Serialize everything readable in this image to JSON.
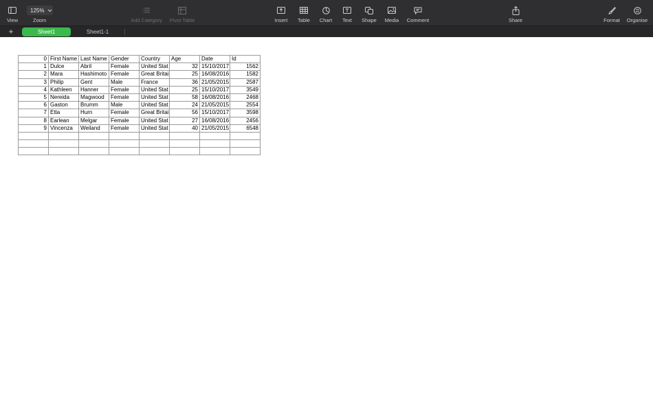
{
  "toolbar": {
    "view_label": "View",
    "zoom_value": "125%",
    "zoom_label": "Zoom",
    "add_category_label": "Add Category",
    "pivot_table_label": "Pivot Table",
    "insert_label": "Insert",
    "table_label": "Table",
    "chart_label": "Chart",
    "text_label": "Text",
    "shape_label": "Shape",
    "media_label": "Media",
    "comment_label": "Comment",
    "share_label": "Share",
    "format_label": "Format",
    "organise_label": "Organise"
  },
  "tabs": {
    "add_symbol": "+",
    "sheet1": "Sheet1",
    "sheet2": "Sheet1-1"
  },
  "colors": {
    "toolbar_bg": "#2f2f31",
    "active_tab": "#3bb94c"
  },
  "table": {
    "headers": [
      "0",
      "First Name",
      "Last Name",
      "Gender",
      "Country",
      "Age",
      "Date",
      "Id"
    ],
    "rows": [
      [
        "1",
        "Dulce",
        "Abril",
        "Female",
        "United Stat",
        "32",
        "15/10/2017",
        "1562"
      ],
      [
        "2",
        "Mara",
        "Hashimoto",
        "Female",
        "Great Britai",
        "25",
        "16/08/2016",
        "1582"
      ],
      [
        "3",
        "Philip",
        "Gent",
        "Male",
        "France",
        "36",
        "21/05/2015",
        "2587"
      ],
      [
        "4",
        "Kathleen",
        "Hanner",
        "Female",
        "United Stat",
        "25",
        "15/10/2017",
        "3549"
      ],
      [
        "5",
        "Nereida",
        "Magwood",
        "Female",
        "United Stat",
        "58",
        "16/08/2016",
        "2468"
      ],
      [
        "6",
        "Gaston",
        "Brumm",
        "Male",
        "United Stat",
        "24",
        "21/05/2015",
        "2554"
      ],
      [
        "7",
        "Etta",
        "Hurn",
        "Female",
        "Great Britai",
        "56",
        "15/10/2017",
        "3598"
      ],
      [
        "8",
        "Earlean",
        "Melgar",
        "Female",
        "United Stat",
        "27",
        "16/08/2016",
        "2456"
      ],
      [
        "9",
        "Vincenza",
        "Weiland",
        "Female",
        "United Stat",
        "40",
        "21/05/2015",
        "6548"
      ]
    ]
  }
}
